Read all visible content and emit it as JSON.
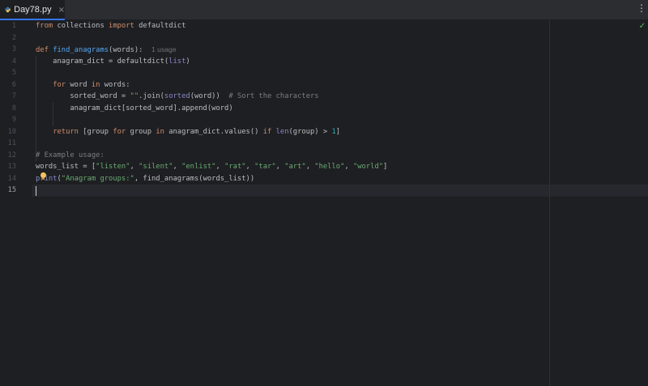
{
  "tab": {
    "filename": "Day78.py",
    "close_glyph": "×"
  },
  "toolbar": {
    "more_glyph": "⋮",
    "status_glyph": "✓"
  },
  "editor": {
    "current_line": 15,
    "line_numbers": [
      "1",
      "2",
      "3",
      "4",
      "5",
      "6",
      "7",
      "8",
      "9",
      "10",
      "11",
      "12",
      "13",
      "14",
      "15"
    ],
    "lines": [
      [
        [
          "kw",
          "from"
        ],
        [
          "p",
          " collections "
        ],
        [
          "kw",
          "import"
        ],
        [
          "p",
          " defaultdict"
        ]
      ],
      [],
      [
        [
          "kw",
          "def"
        ],
        [
          "p",
          " "
        ],
        [
          "fn",
          "find_anagrams"
        ],
        [
          "p",
          "(words):  "
        ],
        [
          "hint",
          "1 usage"
        ]
      ],
      [
        [
          "p",
          "    anagram_dict = defaultdict("
        ],
        [
          "bi",
          "list"
        ],
        [
          "p",
          ")"
        ]
      ],
      [],
      [
        [
          "p",
          "    "
        ],
        [
          "kw",
          "for"
        ],
        [
          "p",
          " word "
        ],
        [
          "kw",
          "in"
        ],
        [
          "p",
          " words:"
        ]
      ],
      [
        [
          "p",
          "        sorted_word = "
        ],
        [
          "str",
          "\"\""
        ],
        [
          "p",
          ".join("
        ],
        [
          "bi",
          "sorted"
        ],
        [
          "p",
          "(word))  "
        ],
        [
          "cmt",
          "# Sort the characters"
        ]
      ],
      [
        [
          "p",
          "        anagram_dict[sorted_word].append(word)"
        ]
      ],
      [],
      [
        [
          "p",
          "    "
        ],
        [
          "kw",
          "return"
        ],
        [
          "p",
          " [group "
        ],
        [
          "kw",
          "for"
        ],
        [
          "p",
          " group "
        ],
        [
          "kw",
          "in"
        ],
        [
          "p",
          " anagram_dict.values() "
        ],
        [
          "kw",
          "if"
        ],
        [
          "p",
          " "
        ],
        [
          "bi",
          "len"
        ],
        [
          "p",
          "(group) > "
        ],
        [
          "num",
          "1"
        ],
        [
          "p",
          "]"
        ]
      ],
      [],
      [
        [
          "cmt",
          "# Example usage:"
        ]
      ],
      [
        [
          "p",
          "words_list = ["
        ],
        [
          "str",
          "\"listen\""
        ],
        [
          "p",
          ", "
        ],
        [
          "str",
          "\"silent\""
        ],
        [
          "p",
          ", "
        ],
        [
          "str",
          "\"enlist\""
        ],
        [
          "p",
          ", "
        ],
        [
          "str",
          "\"rat\""
        ],
        [
          "p",
          ", "
        ],
        [
          "str",
          "\"tar\""
        ],
        [
          "p",
          ", "
        ],
        [
          "str",
          "\"art\""
        ],
        [
          "p",
          ", "
        ],
        [
          "str",
          "\"hello\""
        ],
        [
          "p",
          ", "
        ],
        [
          "str",
          "\"world\""
        ],
        [
          "p",
          "]"
        ]
      ],
      [
        [
          "bi",
          "print"
        ],
        [
          "p",
          "("
        ],
        [
          "str",
          "\"Anagram groups:\""
        ],
        [
          "p",
          ", find_anagrams(words_list))"
        ]
      ],
      []
    ]
  }
}
